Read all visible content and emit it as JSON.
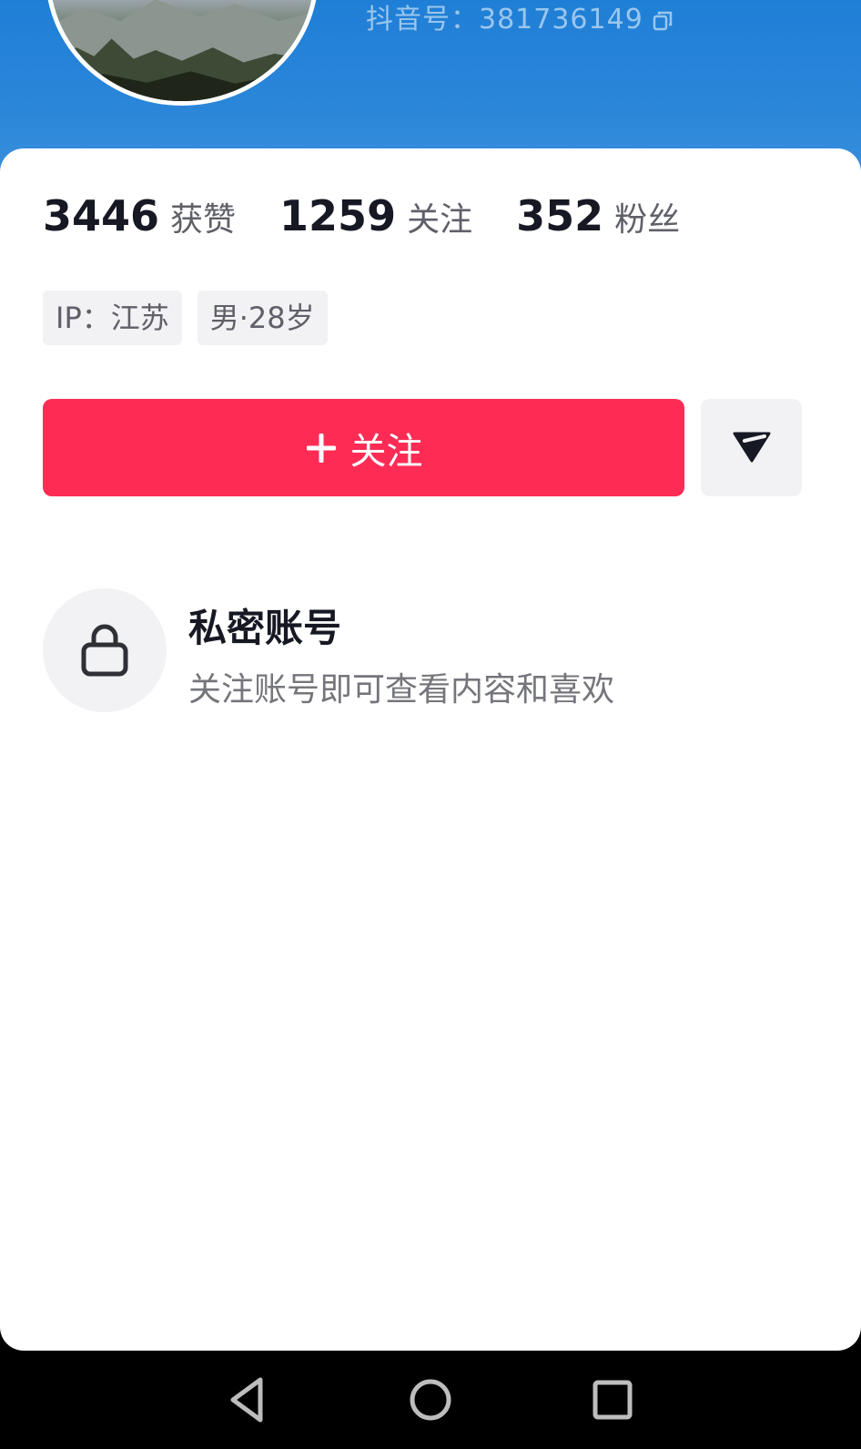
{
  "header": {
    "douyin_id": "抖音号：381736149",
    "copy_icon": "copy-icon",
    "background": "#2b86d9"
  },
  "stats": [
    {
      "value": "3446",
      "label": "获赞"
    },
    {
      "value": "1259",
      "label": "关注"
    },
    {
      "value": "352",
      "label": "粉丝"
    }
  ],
  "tags": [
    "IP：江苏",
    "男·28岁"
  ],
  "actions": {
    "follow_label": "关注",
    "follow_icon": "plus-icon",
    "follow_color": "#fe2c55",
    "share_icon": "send-icon"
  },
  "private": {
    "icon": "lock-icon",
    "title": "私密账号",
    "description": "关注账号即可查看内容和喜欢"
  },
  "navbar": {
    "back_icon": "back-triangle-icon",
    "home_icon": "home-circle-icon",
    "recent_icon": "recent-square-icon"
  }
}
